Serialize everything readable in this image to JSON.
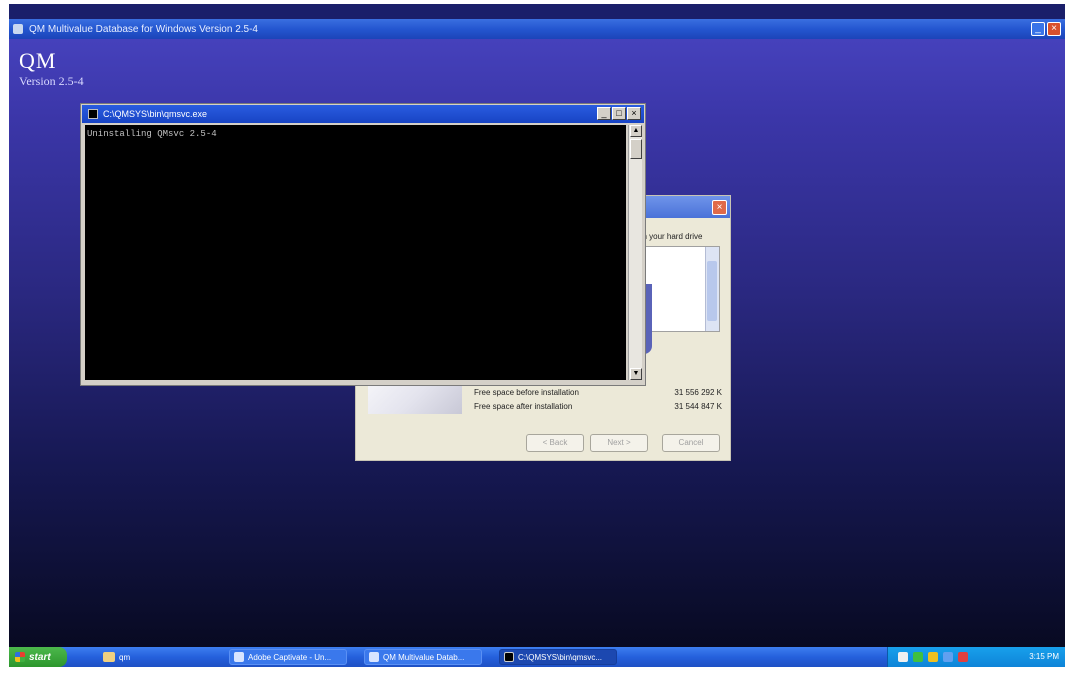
{
  "installer": {
    "window_title": "QM Multivalue Database for Windows Version 2.5-4",
    "app_name": "QM",
    "version": "Version 2.5-4"
  },
  "console": {
    "title": "C:\\QMSYS\\bin\\qmsvc.exe",
    "output_line": "Uninstalling QMsvc 2.5-4",
    "buttons": {
      "minimize": "_",
      "restore": "□",
      "close": "×"
    }
  },
  "setup_dialog": {
    "header_text": "on your hard drive",
    "close": "×",
    "space_before_label": "Free space before installation",
    "space_before_value": "31 556 292 K",
    "space_after_label": "Free space after installation",
    "space_after_value": "31 544 847 K",
    "back_label": "< Back",
    "next_label": "Next >",
    "cancel_label": "Cancel"
  },
  "taskbar": {
    "start_label": "start",
    "quick_launch_label": "qm",
    "tasks": [
      {
        "label": "Adobe Captivate - Un...",
        "icon": "captivate-icon"
      },
      {
        "label": "QM Multivalue Datab...",
        "icon": "qm-icon"
      },
      {
        "label": "C:\\QMSYS\\bin\\qmsvc...",
        "icon": "console-icon"
      }
    ],
    "clock": "3:15 PM"
  }
}
